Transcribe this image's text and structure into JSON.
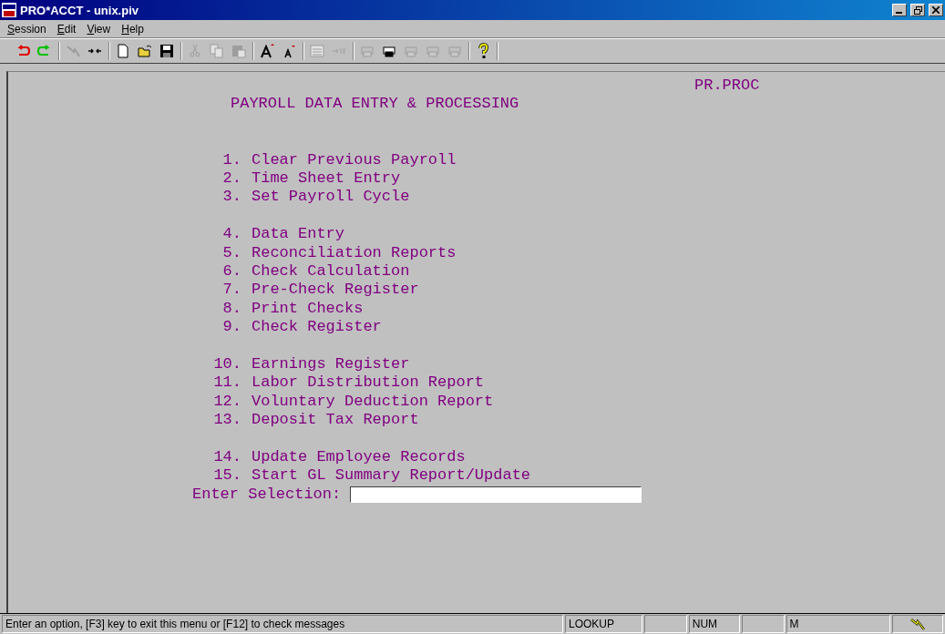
{
  "window": {
    "title": "PRO*ACCT - unix.piv"
  },
  "menu": [
    "Session",
    "Edit",
    "View",
    "Help"
  ],
  "toolbar": [
    [
      {
        "kind": "undo",
        "disabled": false
      },
      {
        "kind": "redo",
        "disabled": false
      }
    ],
    [
      {
        "kind": "connect",
        "disabled": true
      },
      {
        "kind": "split",
        "disabled": false
      }
    ],
    [
      {
        "kind": "new",
        "disabled": false
      },
      {
        "kind": "open",
        "disabled": false
      },
      {
        "kind": "save",
        "disabled": false
      }
    ],
    [
      {
        "kind": "cut",
        "disabled": true
      },
      {
        "kind": "copy",
        "disabled": true
      },
      {
        "kind": "paste",
        "disabled": true
      }
    ],
    [
      {
        "kind": "font-up",
        "disabled": false
      },
      {
        "kind": "font-down",
        "disabled": false
      }
    ],
    [
      {
        "kind": "list",
        "disabled": true
      },
      {
        "kind": "tab",
        "disabled": true
      }
    ],
    [
      {
        "kind": "print",
        "disabled": true
      },
      {
        "kind": "print",
        "disabled": false
      },
      {
        "kind": "print",
        "disabled": true
      },
      {
        "kind": "print",
        "disabled": true
      },
      {
        "kind": "print",
        "disabled": true
      }
    ],
    [
      {
        "kind": "help",
        "disabled": false
      }
    ]
  ],
  "screen": {
    "program": "PR.PROC",
    "title": "PAYROLL DATA ENTRY & PROCESSING",
    "groups": [
      [
        {
          "number": "1.",
          "label": "Clear Previous Payroll"
        },
        {
          "number": "2.",
          "label": "Time Sheet Entry"
        },
        {
          "number": "3.",
          "label": "Set Payroll Cycle"
        }
      ],
      [
        {
          "number": "4.",
          "label": "Data Entry"
        },
        {
          "number": "5.",
          "label": "Reconciliation Reports"
        },
        {
          "number": "6.",
          "label": "Check Calculation"
        },
        {
          "number": "7.",
          "label": "Pre-Check Register"
        },
        {
          "number": "8.",
          "label": "Print Checks"
        },
        {
          "number": "9.",
          "label": "Check Register"
        }
      ],
      [
        {
          "number": "10.",
          "label": "Earnings Register"
        },
        {
          "number": "11.",
          "label": "Labor Distribution Report"
        },
        {
          "number": "12.",
          "label": "Voluntary Deduction Report"
        },
        {
          "number": "13.",
          "label": "Deposit Tax Report"
        }
      ],
      [
        {
          "number": "14.",
          "label": "Update Employee Records"
        },
        {
          "number": "15.",
          "label": "Start GL Summary Report/Update"
        }
      ]
    ],
    "prompt": "Enter Selection:"
  },
  "status_bar": {
    "message": "Enter an option, [F3] key to exit this menu or [F12] to check messages",
    "panels": [
      "LOOKUP",
      "NUM",
      "M"
    ]
  }
}
